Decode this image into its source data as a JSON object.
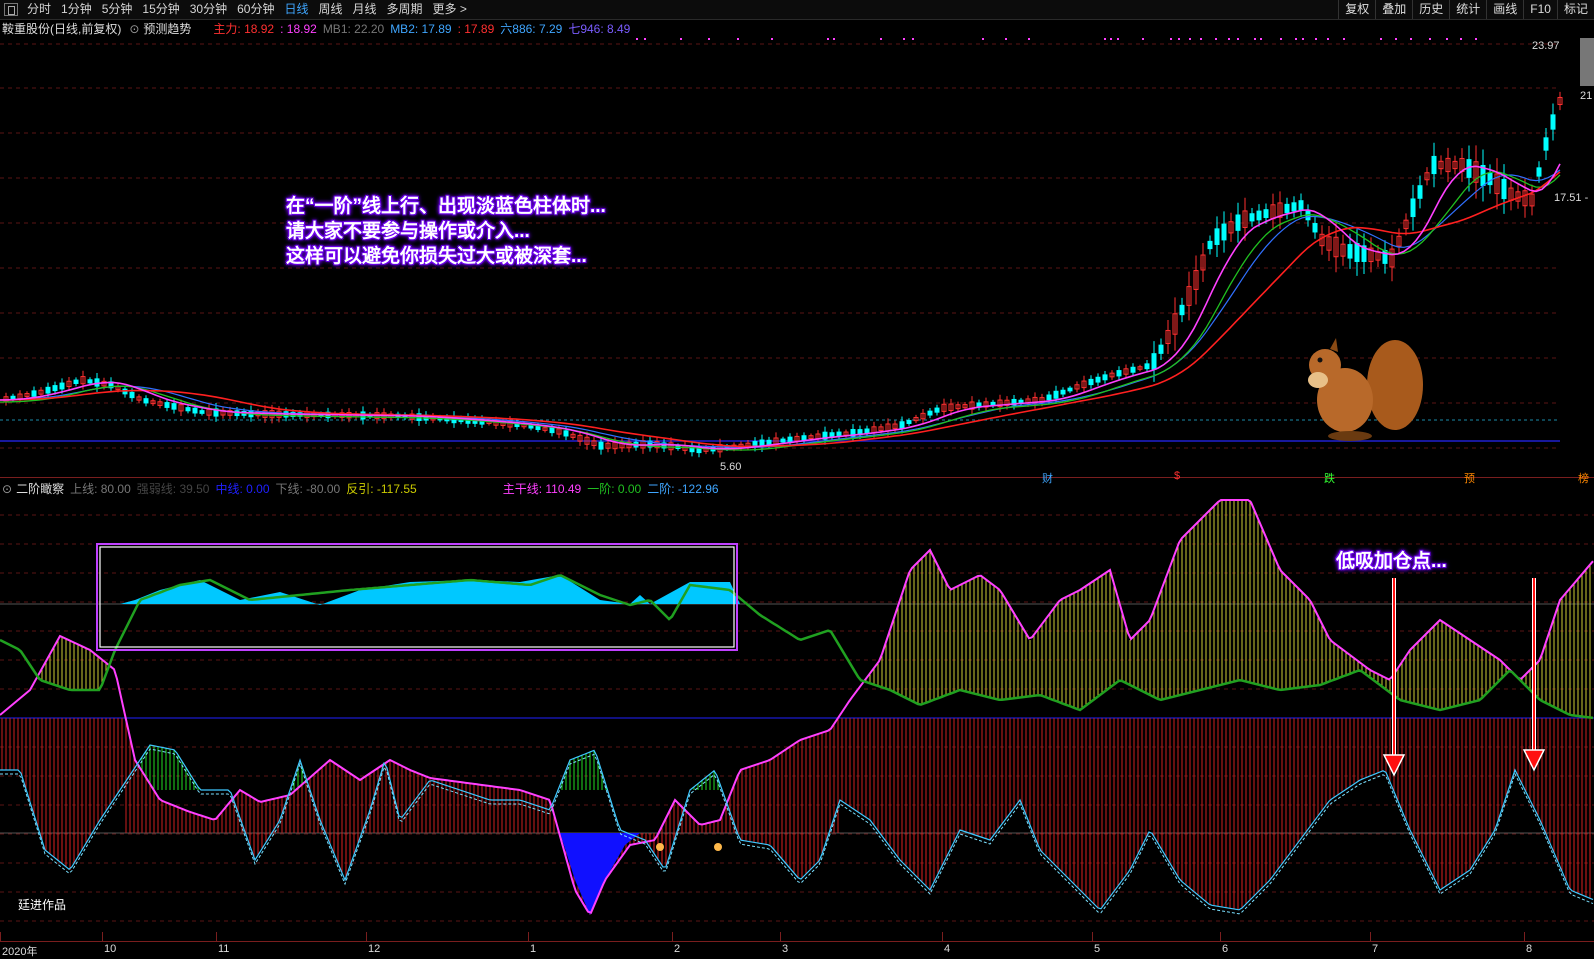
{
  "toolbar": {
    "periods": [
      "分时",
      "1分钟",
      "5分钟",
      "15分钟",
      "30分钟",
      "60分钟",
      "日线",
      "周线",
      "月线",
      "多周期",
      "更多 >"
    ],
    "active_period": "日线",
    "right_buttons": [
      "复权",
      "叠加",
      "历史",
      "统计",
      "画线",
      "F10",
      "标记"
    ]
  },
  "main_chart": {
    "stock_title": "鞍重股份(日线,前复权)",
    "predict_label": "预测趋势",
    "indicators": [
      {
        "label": "主力:",
        "value": "18.92",
        "color": "#ff3030"
      },
      {
        "label": ":",
        "value": "18.92",
        "color": "#ff40ff"
      },
      {
        "label": "MB1:",
        "value": "22.20",
        "color": "#777777"
      },
      {
        "label": "MB2:",
        "value": "17.89",
        "color": "#3fa6ff"
      },
      {
        "label": ":",
        "value": "17.89",
        "color": "#ff3030"
      },
      {
        "label": "六886:",
        "value": "7.29",
        "color": "#3fa6ff"
      },
      {
        "label": "七946:",
        "value": "8.49",
        "color": "#7a5cff"
      }
    ],
    "price_high": "23.97",
    "price_low": "5.60",
    "price_right": "17.51 -",
    "price_top_right": "21",
    "annotation": [
      "在“一阶”线上行、出现淡蓝色柱体时...",
      "请大家不要参与操作或介入...",
      "这样可以避免你损失过大或被深套..."
    ],
    "events": [
      {
        "text": "财",
        "color": "#3fa6ff"
      },
      {
        "text": "$",
        "color": "#ff3030"
      },
      {
        "text": "跌",
        "color": "#33ff33"
      },
      {
        "text": "预",
        "color": "#ff8800"
      },
      {
        "text": "榜",
        "color": "#ff8800"
      }
    ]
  },
  "sub_chart": {
    "indicator_name": "二阶瞰察",
    "params": [
      {
        "label": "上线:",
        "value": "80.00",
        "color": "#777777"
      },
      {
        "label": "强弱线:",
        "value": "39.50",
        "color": "#444444"
      },
      {
        "label": "中线:",
        "value": "0.00",
        "color": "#2020ff"
      },
      {
        "label": "下线:",
        "value": "-80.00",
        "color": "#777777"
      },
      {
        "label": "反引:",
        "value": "-117.55",
        "color": "#cccc00"
      },
      {
        "label": "主干线:",
        "value": "110.49",
        "color": "#ff40ff"
      },
      {
        "label": "一阶:",
        "value": "0.00",
        "color": "#20c020"
      },
      {
        "label": "二阶:",
        "value": "-122.96",
        "color": "#3fa6ff"
      }
    ],
    "annotation": "低吸加仓点...",
    "author": "廷进作品"
  },
  "x_axis": [
    "2020年",
    "10",
    "11",
    "12",
    "1",
    "2",
    "3",
    "4",
    "5",
    "6",
    "7",
    "8"
  ],
  "colors": {
    "up": "#ff3030",
    "down": "#00ffff",
    "ma_fast": "#ff40ff",
    "ma_slow": "#ff2020",
    "ma_green": "#20c020",
    "ma_blue": "#3070ff"
  }
}
